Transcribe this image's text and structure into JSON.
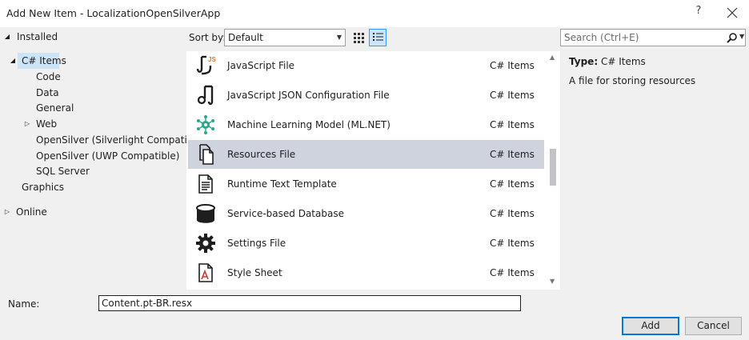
{
  "window": {
    "title": "Add New Item - LocalizationOpenSilverApp",
    "help_glyph": "?"
  },
  "tree": {
    "installed": "Installed",
    "items": [
      {
        "label": "C# Items",
        "expanded": true,
        "selected": true
      },
      {
        "label": "Code"
      },
      {
        "label": "Data"
      },
      {
        "label": "General"
      },
      {
        "label": "Web",
        "expandable": true
      },
      {
        "label": "OpenSilver (Silverlight Compatible)"
      },
      {
        "label": "OpenSilver (UWP Compatible)"
      },
      {
        "label": "SQL Server"
      },
      {
        "label": "Graphics"
      }
    ],
    "online": "Online"
  },
  "toolbar": {
    "sort_label": "Sort by:",
    "sort_value": "Default",
    "search_placeholder": "Search (Ctrl+E)"
  },
  "templates": [
    {
      "name": "JavaScript File",
      "type": "C# Items",
      "icon": "javascript-file-icon"
    },
    {
      "name": "JavaScript JSON Configuration File",
      "type": "C# Items",
      "icon": "json-config-file-icon"
    },
    {
      "name": "Machine Learning Model (ML.NET)",
      "type": "C# Items",
      "icon": "ml-model-icon"
    },
    {
      "name": "Resources File",
      "type": "C# Items",
      "icon": "resources-file-icon",
      "selected": true
    },
    {
      "name": "Runtime Text Template",
      "type": "C# Items",
      "icon": "text-template-icon"
    },
    {
      "name": "Service-based Database",
      "type": "C# Items",
      "icon": "database-icon"
    },
    {
      "name": "Settings File",
      "type": "C# Items",
      "icon": "settings-gear-icon"
    },
    {
      "name": "Style Sheet",
      "type": "C# Items",
      "icon": "style-sheet-icon"
    }
  ],
  "details": {
    "type_label": "Type:",
    "type_value": "C# Items",
    "description": "A file for storing resources"
  },
  "form": {
    "name_label": "Name:",
    "name_value": "Content.pt-BR.resx",
    "add_label": "Add",
    "cancel_label": "Cancel"
  },
  "colors": {
    "selection": "#cfd3dd",
    "tree_selection": "#cce4f7",
    "accent": "#0078d7",
    "ml_icon": "#2aa889"
  }
}
